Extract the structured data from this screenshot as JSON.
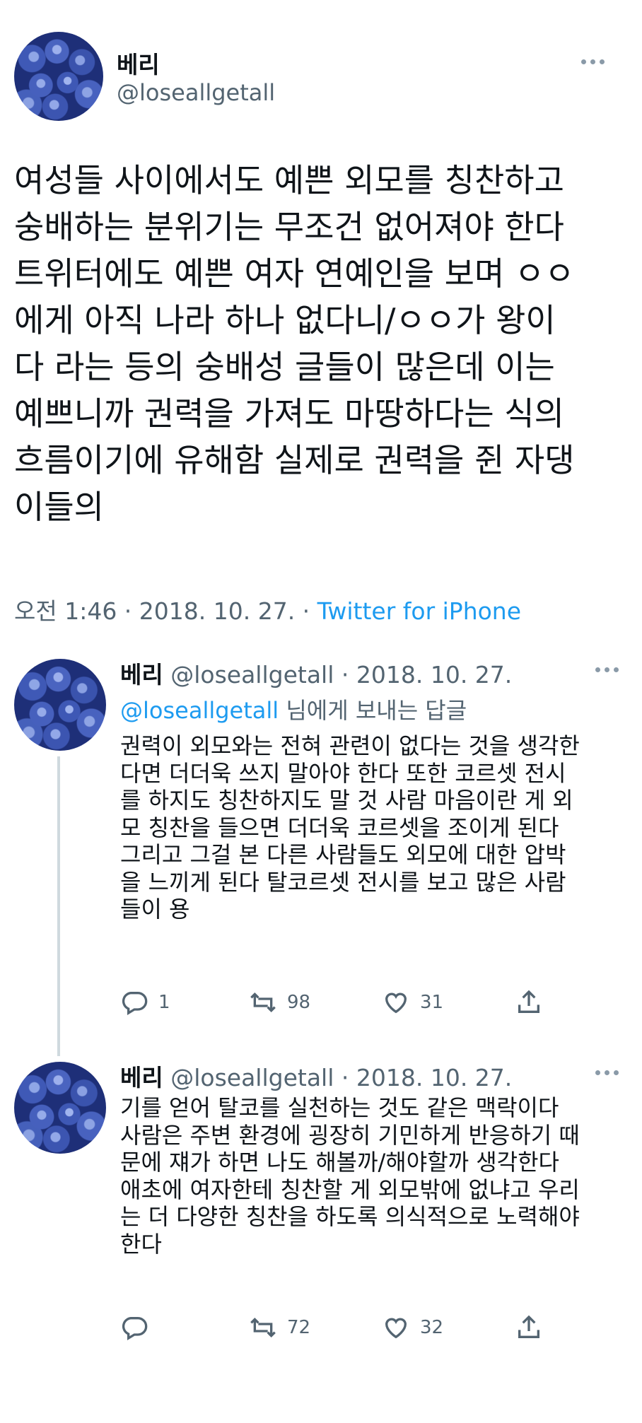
{
  "main_tweet": {
    "display_name": "베리",
    "handle": "@loseallgetall",
    "body": "여성들 사이에서도 예쁜 외모를 칭찬하고\n숭배하는 분위기는 무조건 없어져야 한다\n트위터에도 예쁜 여자 연예인을 보며 ㅇㅇ\n에게 아직 나라 하나 없다니/ㅇㅇ가 왕이\n다 라는 등의 숭배성 글들이 많은데 이는\n예쁘니까 권력을 가져도 마땅하다는 식의\n흐름이기에 유해함 실제로 권력을 쥔 자댕\n이들의",
    "timestamp": "오전 1:46 · 2018. 10. 27. · ",
    "source": "Twitter for iPhone"
  },
  "replies": [
    {
      "display_name": "베리",
      "handle_date": "@loseallgetall · 2018. 10. 27.",
      "reply_to_handle": "@loseallgetall",
      "reply_to_suffix": " 님에게 보내는 답글",
      "body": "권력이 외모와는 전혀 관련이 없다는 것을 생각한\n다면 더더욱 쓰지 말아야 한다 또한 코르셋 전시\n를 하지도 칭찬하지도 말 것 사람 마음이란 게 외\n모 칭찬을 들으면 더더욱 코르셋을 조이게 된다\n그리고 그걸 본 다른 사람들도 외모에 대한 압박\n을 느끼게 된다 탈코르셋 전시를 보고 많은 사람\n들이 용",
      "replies": "1",
      "retweets": "98",
      "likes": "31"
    },
    {
      "display_name": "베리",
      "handle_date": "@loseallgetall · 2018. 10. 27.",
      "body": "기를 얻어 탈코를 실천하는 것도 같은 맥락이다\n사람은 주변 환경에 굉장히 기민하게 반응하기 때\n문에 쟤가 하면 나도 해볼까/해야할까 생각한다\n애초에 여자한테 칭찬할 게 외모밖에 없냐고 우리\n는 더 다양한 칭찬을 하도록 의식적으로 노력해야\n한다",
      "replies": "",
      "retweets": "72",
      "likes": "32"
    }
  ],
  "icons": {
    "avatar": "blueberry-avatar",
    "more": "more-dots-icon",
    "reply": "reply-bubble-icon",
    "retweet": "retweet-icon",
    "like": "heart-icon",
    "share": "share-icon"
  },
  "colors": {
    "text": "#0f1419",
    "secondary": "#536471",
    "link": "#1d9bf0",
    "thread_line": "#cfd9de"
  }
}
